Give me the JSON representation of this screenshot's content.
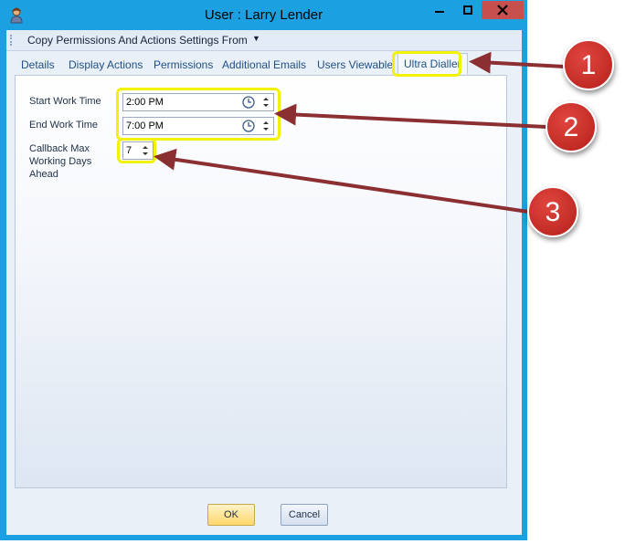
{
  "window": {
    "title": "User : Larry Lender"
  },
  "toolbar": {
    "menu_label": "Copy Permissions And Actions Settings From"
  },
  "tabs": [
    {
      "label": "Details"
    },
    {
      "label": "Display Actions"
    },
    {
      "label": "Permissions"
    },
    {
      "label": "Additional Emails"
    },
    {
      "label": "Users Viewable"
    },
    {
      "label": "Ultra Dialler",
      "selected": true
    }
  ],
  "form": {
    "start_label": "Start Work Time",
    "start_value": "2:00 PM",
    "end_label": "End Work Time",
    "end_value": "7:00 PM",
    "callback_label_1": "Callback Max",
    "callback_label_2": "Working Days",
    "callback_label_3": "Ahead",
    "callback_value": "7"
  },
  "buttons": {
    "ok": "OK",
    "cancel": "Cancel"
  },
  "callouts": [
    {
      "number": "1"
    },
    {
      "number": "2"
    },
    {
      "number": "3"
    }
  ],
  "colors": {
    "window_border": "#1ba1e2",
    "close_button": "#c7504e",
    "highlight": "#f2f209",
    "callout": "#c9302c",
    "arrow": "#8b2f33"
  }
}
